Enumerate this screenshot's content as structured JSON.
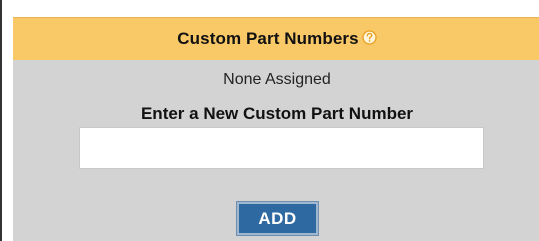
{
  "panel": {
    "title": "Custom Part Numbers",
    "help_icon": "question-circle-icon",
    "status_text": "None Assigned",
    "input_label": "Enter a New Custom Part Number",
    "input_value": "",
    "input_placeholder": "",
    "add_button_label": "ADD"
  },
  "colors": {
    "header_background": "#f9c867",
    "body_background": "#d3d3d3",
    "button_background": "#2e6aa1",
    "help_icon": "#e8a020"
  }
}
